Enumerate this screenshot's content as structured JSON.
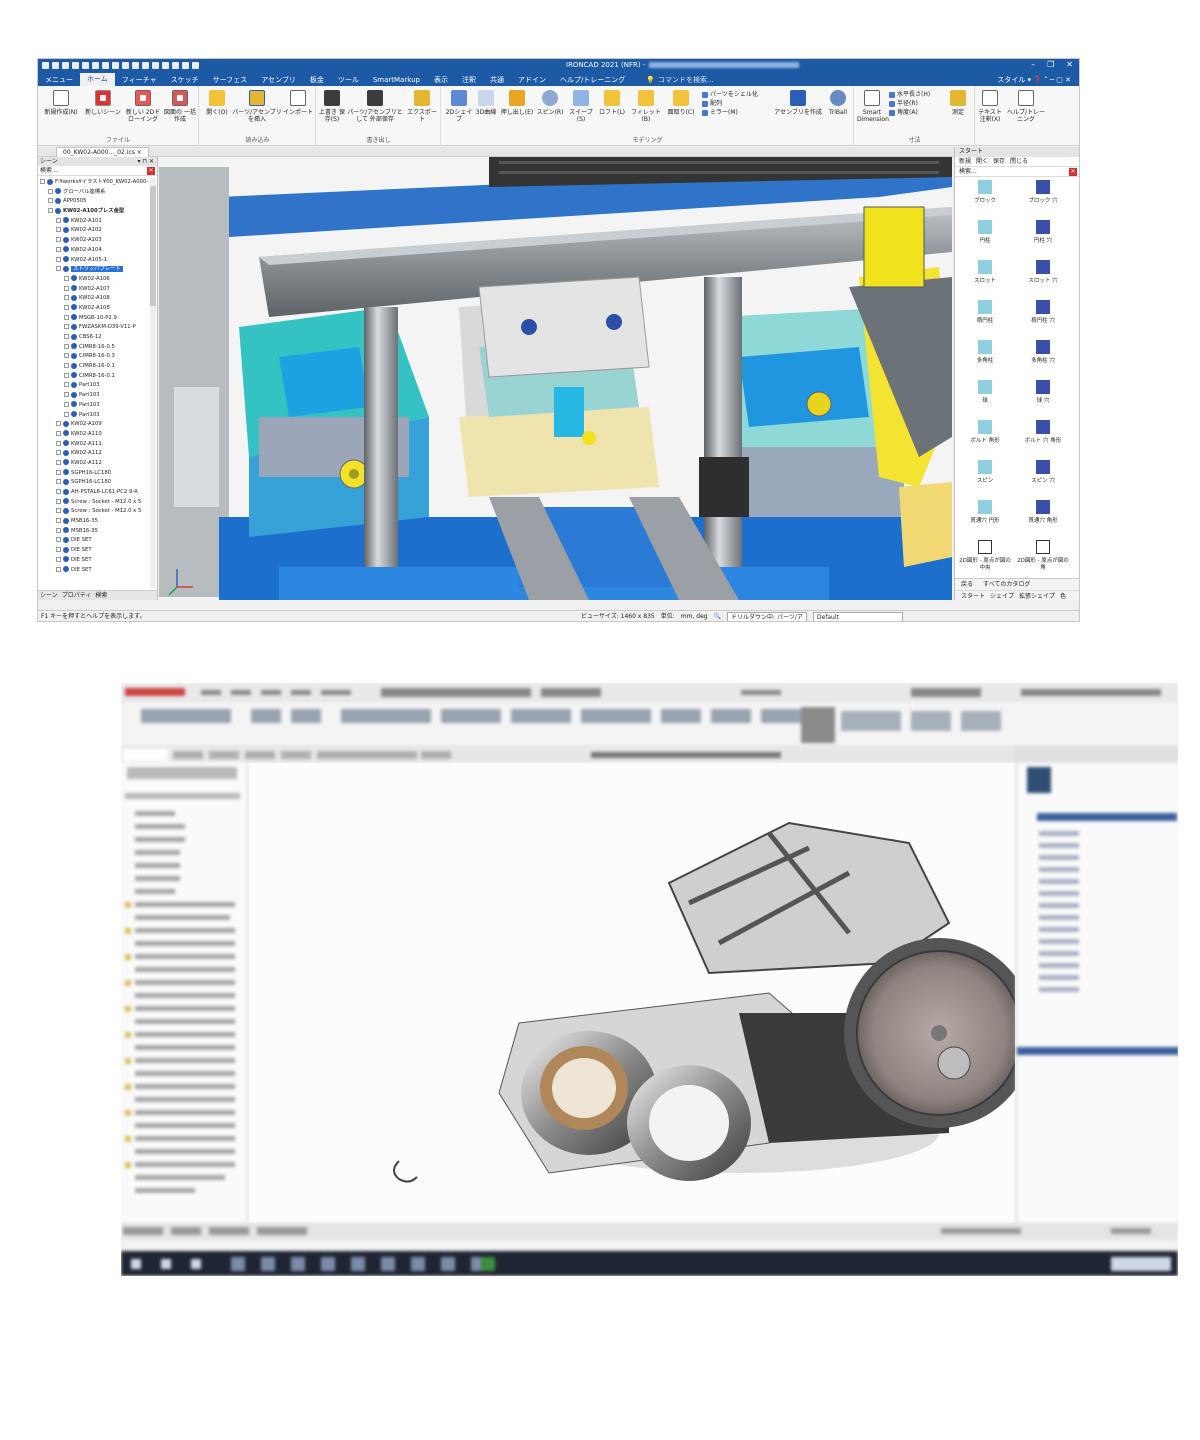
{
  "app": {
    "title": "IRONCAD 2021 (NFR) -",
    "menus": [
      "メニュー",
      "ホーム",
      "フィーチャ",
      "スケッチ",
      "サーフェス",
      "アセンブリ",
      "板金",
      "ツール",
      "SmartMarkup",
      "表示",
      "注釈",
      "共通",
      "アドイン",
      "ヘルプ/トレーニング"
    ],
    "active_menu": "ホーム",
    "command_search": "コマンドを検索...",
    "style_label": "スタイル"
  },
  "ribbon": {
    "file_group": "ファイル",
    "read_group": "読み込み",
    "write_group": "書き出し",
    "modeling_group": "モデリング",
    "dimension_group": "寸法",
    "buttons": {
      "new_file": "新規作成(N)",
      "new_scene": "新しいシーン",
      "new_2d": "新しい 2Dドローイング",
      "bulk_drawing": "図面の 一括作成",
      "open": "開く(O)",
      "insert_part": "パーツ/アセンブリ を挿入",
      "import": "インポート",
      "overwrite_save": "上書き 保存(S)",
      "save_external": "パーツ/アセンブリとして 外部保存",
      "export": "エクスポート",
      "shape2d": "2Dシェイプ",
      "curve3d": "3D曲線",
      "extrude": "押し出し(E)",
      "spin": "スピン(R)",
      "sweep": "スイープ(S)",
      "loft": "ロフト(L)",
      "fillet": "フィレット(B)",
      "chamfer": "面取り(C)",
      "shell": "パーツをシェル化",
      "array": "配列",
      "mirror": "ミラー(M)",
      "create_assembly": "アセンブリを作成",
      "triball": "TriBall",
      "smart_dimension": "Smart Dimension",
      "horizontal": "水平長さ(H)",
      "radius": "半径(R)",
      "angle": "角度(A)",
      "measure": "測定",
      "text_note": "テキスト 注釈(X)",
      "help_training": "ヘルプ/トレーニング"
    }
  },
  "doc_tab": "00_KW02-A000..._02.ics",
  "scene_panel": {
    "title": "シーン",
    "search": "検索...",
    "tree": [
      {
        "label": "F:¥works¥イラスト¥00_KW02-A000-",
        "depth": 0
      },
      {
        "label": "グローバル座標系",
        "depth": 1
      },
      {
        "label": "APP0505",
        "depth": 1
      },
      {
        "label": "KW02-A100プレス金型",
        "depth": 1,
        "bold": true
      },
      {
        "label": "KW02-A101",
        "depth": 2
      },
      {
        "label": "KW02-A102",
        "depth": 2
      },
      {
        "label": "KW02-A103",
        "depth": 2
      },
      {
        "label": "KW02-A104",
        "depth": 2
      },
      {
        "label": "KW02-A105-1",
        "depth": 2
      },
      {
        "label": "ストリッパプレート",
        "depth": 2,
        "selected": true
      },
      {
        "label": "KW02-A106",
        "depth": 3
      },
      {
        "label": "KW02-A107",
        "depth": 3
      },
      {
        "label": "KW02-A108",
        "depth": 3
      },
      {
        "label": "KW02-A108",
        "depth": 3
      },
      {
        "label": "MSGB-10-P2.9",
        "depth": 3
      },
      {
        "label": "FWZASKM-D39-V11-P",
        "depth": 3
      },
      {
        "label": "CBS6-12",
        "depth": 3
      },
      {
        "label": "CIMR8-16-0.5",
        "depth": 3
      },
      {
        "label": "CIMR8-16-0.3",
        "depth": 3
      },
      {
        "label": "CIMR8-16-0.1",
        "depth": 3
      },
      {
        "label": "CIMR8-16-0.1",
        "depth": 3
      },
      {
        "label": "Part103",
        "depth": 3
      },
      {
        "label": "Part103",
        "depth": 3
      },
      {
        "label": "Part103",
        "depth": 3
      },
      {
        "label": "Part103",
        "depth": 3
      },
      {
        "label": "KW02-A109",
        "depth": 2
      },
      {
        "label": "KW02-A110",
        "depth": 2
      },
      {
        "label": "KW02-A111",
        "depth": 2
      },
      {
        "label": "KW02-A112",
        "depth": 2
      },
      {
        "label": "KW02-A112",
        "depth": 2
      },
      {
        "label": "SGPH16-LC180",
        "depth": 2
      },
      {
        "label": "SGPH16-LC180",
        "depth": 2
      },
      {
        "label": "AH-PSTAL8-LC61-PC2.9-R",
        "depth": 2
      },
      {
        "label": "Screw : Socket - M12.0 x 5",
        "depth": 2
      },
      {
        "label": "Screw : Socket - M12.0 x 5",
        "depth": 2
      },
      {
        "label": "MSB16-35",
        "depth": 2
      },
      {
        "label": "MSB16-35",
        "depth": 2
      },
      {
        "label": "DIE SET",
        "depth": 2
      },
      {
        "label": "DIE SET",
        "depth": 2
      },
      {
        "label": "DIE SET",
        "depth": 2
      },
      {
        "label": "DIE SET",
        "depth": 2
      }
    ],
    "tabs": [
      "シーン",
      "プロパティ",
      "検索"
    ]
  },
  "catalog_panel": {
    "title": "スタート",
    "tools": [
      "新規",
      "開く",
      "保存",
      "閉じる"
    ],
    "search": "検索...",
    "items": [
      "ブロック",
      "ブロック 穴",
      "円柱",
      "円柱 穴",
      "スロット",
      "スロット 穴",
      "楕円柱",
      "楕円柱 穴",
      "多角柱",
      "多角柱 穴",
      "球",
      "球 穴",
      "ボルト 角形",
      "ボルト 穴 角形",
      "スピン",
      "スピン 穴",
      "貫通穴 円形",
      "貫通穴 角形",
      "2D図形 - 原点が図の中央",
      "2D図形 - 原点が図の角"
    ],
    "back": "戻る",
    "all_catalogs": "すべてのカタログ",
    "bottom_tabs": [
      "スタート",
      "シェイプ",
      "拡張シェイプ",
      "色"
    ]
  },
  "statusbar": {
    "help": "F1 キーを押すとヘルプを表示します。",
    "view_size": "ビューサイズ: 1460 x 835",
    "units_label": "単位:",
    "units": "mm, deg",
    "drill_mode": "ドリルダウン中: パーツ/ア",
    "style_value": "Default"
  },
  "colors": {
    "accent": "#1c5aa6",
    "selected": "#2b72d6",
    "close_red": "#d9302c",
    "teal": "#35c2c2",
    "blue_base": "#1976d2",
    "yellow": "#f5e51a"
  }
}
